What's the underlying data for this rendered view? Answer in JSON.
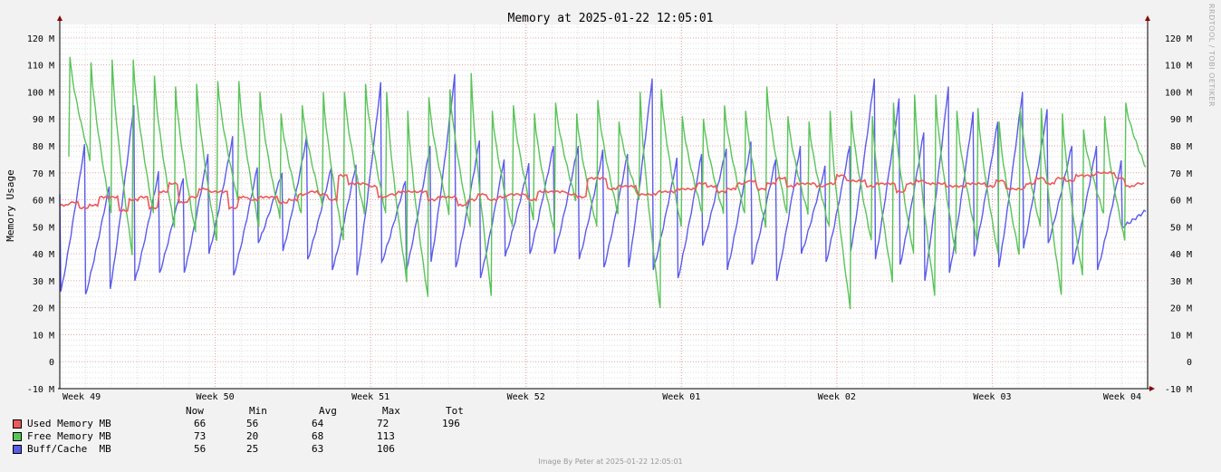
{
  "chart_data": {
    "type": "line",
    "title": "Memory at 2025-01-22 12:05:01",
    "ylabel": "Memory Usage",
    "xlabel": "",
    "ylim": [
      -10,
      125
    ],
    "y_ticks": [
      -10,
      0,
      10,
      20,
      30,
      40,
      50,
      60,
      70,
      80,
      90,
      100,
      110,
      120
    ],
    "y_tick_labels": [
      "-10 M",
      "0",
      "10 M",
      "20 M",
      "30 M",
      "40 M",
      "50 M",
      "60 M",
      "70 M",
      "80 M",
      "90 M",
      "100 M",
      "110 M",
      "120 M"
    ],
    "x_tick_labels": [
      "Week 49",
      "Week 50",
      "Week 51",
      "Week 52",
      "Week 01",
      "Week 02",
      "Week 03",
      "Week 04"
    ],
    "grid": true,
    "legend_placement": "bottom",
    "series": [
      {
        "name": "Used Memory MB",
        "color": "#ea5b5b",
        "values": [
          58,
          59,
          57,
          58,
          61,
          61,
          56,
          60,
          61,
          57,
          63,
          66,
          59,
          61,
          64,
          63,
          63,
          57,
          61,
          60,
          61,
          61,
          59,
          60,
          62,
          63,
          62,
          60,
          69,
          66,
          66,
          65,
          61,
          62,
          63,
          63,
          63,
          60,
          61,
          61,
          58,
          60,
          62,
          60,
          61,
          62,
          62,
          60,
          63,
          63,
          63,
          62,
          61,
          68,
          68,
          64,
          65,
          65,
          62,
          62,
          63,
          63,
          64,
          64,
          66,
          65,
          63,
          64,
          66,
          67,
          64,
          66,
          68,
          65,
          66,
          66,
          65,
          66,
          69,
          67,
          67,
          65,
          66,
          66,
          63,
          66,
          67,
          66,
          66,
          65,
          65,
          66,
          66,
          65,
          67,
          64,
          64,
          66,
          68,
          66,
          68,
          67,
          69,
          69,
          70,
          70,
          68,
          65,
          66
        ]
      },
      {
        "name": "Free Memory MB",
        "color": "#5ac45a",
        "peaks": [
          113,
          111,
          112,
          112,
          106,
          102,
          103,
          104,
          104,
          100,
          92,
          95,
          100,
          100,
          103,
          100,
          93,
          98,
          101,
          107,
          93,
          95,
          92,
          96,
          92,
          97,
          89,
          100,
          101,
          91,
          90,
          95,
          93,
          102,
          91,
          89,
          93,
          93,
          91,
          96,
          99,
          99,
          93,
          94,
          89,
          94,
          94,
          92,
          86,
          91,
          96
        ],
        "troughs": [
          75,
          55,
          40,
          55,
          50,
          48,
          45,
          60,
          50,
          53,
          55,
          58,
          45,
          55,
          55,
          30,
          24,
          55,
          50,
          25,
          50,
          53,
          48,
          60,
          50,
          55,
          60,
          20,
          50,
          55,
          55,
          55,
          50,
          55,
          55,
          50,
          20,
          45,
          30,
          40,
          25,
          40,
          45,
          40,
          40,
          50,
          25,
          32,
          55,
          45,
          72
        ]
      },
      {
        "name": "Buff/Cache  MB",
        "color": "#5b5bea",
        "peaks": [
          80,
          65,
          95,
          70,
          68,
          77,
          83,
          72,
          70,
          83,
          72,
          73,
          103,
          67,
          80,
          106,
          82,
          75,
          73,
          80,
          80,
          78,
          77,
          105,
          75,
          77,
          79,
          81,
          75,
          80,
          72,
          80,
          105,
          97,
          85,
          102,
          92,
          89,
          100,
          93,
          80,
          80,
          74,
          56
        ],
        "troughs": [
          26,
          25,
          27,
          30,
          33,
          33,
          40,
          32,
          44,
          41,
          38,
          34,
          32,
          37,
          34,
          37,
          35,
          31,
          39,
          40,
          40,
          38,
          35,
          35,
          34,
          31,
          43,
          34,
          36,
          30,
          40,
          37,
          41,
          38,
          36,
          30,
          33,
          39,
          35,
          42,
          44,
          36,
          34,
          50
        ]
      }
    ],
    "legend": {
      "headers": [
        "Now",
        "Min",
        "Avg",
        "Max",
        "Tot"
      ],
      "rows": [
        {
          "name": "Used Memory MB",
          "color": "#ea5b5b",
          "now": "66",
          "min": "56",
          "avg": "64",
          "max": "72",
          "tot": "196"
        },
        {
          "name": "Free Memory MB",
          "color": "#5ac45a",
          "now": "73",
          "min": "20",
          "avg": "68",
          "max": "113",
          "tot": ""
        },
        {
          "name": "Buff/Cache  MB",
          "color": "#5b5bea",
          "now": "56",
          "min": "25",
          "avg": "63",
          "max": "106",
          "tot": ""
        }
      ]
    }
  },
  "footer": "Image By Peter at 2025-01-22 12:05:01",
  "watermark": "RRDTOOL / TOBI OETIKER"
}
